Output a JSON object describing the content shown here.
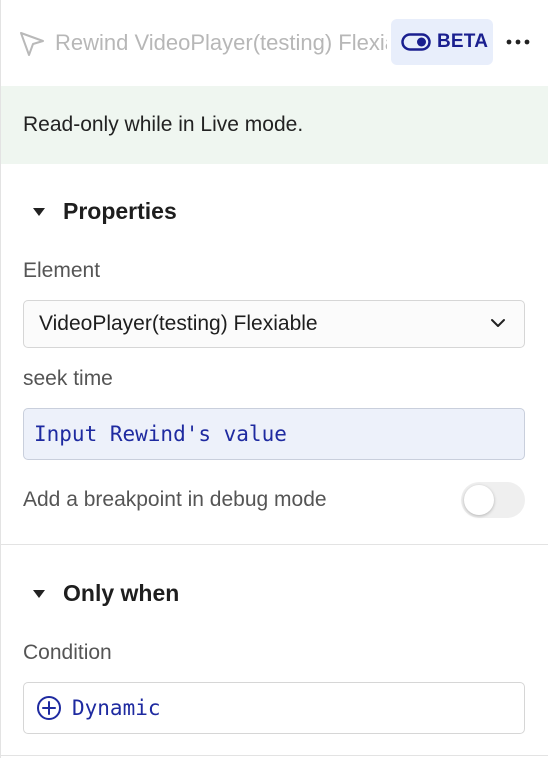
{
  "header": {
    "title": "Rewind VideoPlayer(testing) Flexiable",
    "badge_label": "BETA",
    "more_label": "⋯",
    "icon_cursor": "cursor-arrow-icon",
    "icon_toggle": "toggle-icon"
  },
  "notice": {
    "text": "Read-only while in Live mode."
  },
  "properties": {
    "section_title": "Properties",
    "element_label": "Element",
    "element_value": "VideoPlayer(testing) Flexiable",
    "seek_label": "seek time",
    "seek_value": "Input Rewind's value",
    "breakpoint_label": "Add a breakpoint in debug mode",
    "breakpoint_on": false
  },
  "only_when": {
    "section_title": "Only when",
    "condition_label": "Condition",
    "dynamic_label": "Dynamic"
  },
  "colors": {
    "accent": "#1e2aa0",
    "badge_bg": "#e8eefb",
    "notice_bg": "#eff6f0"
  }
}
